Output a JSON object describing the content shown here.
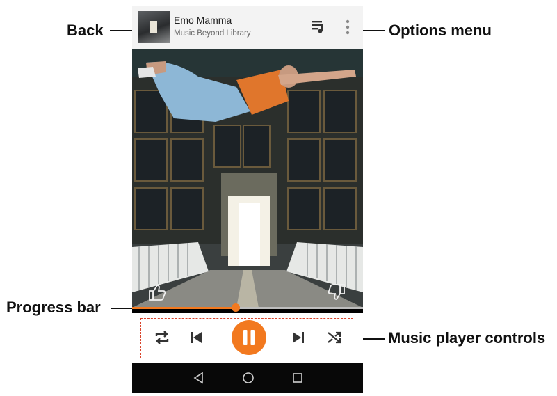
{
  "track": {
    "title": "Emo Mamma",
    "subtitle": "Music Beyond Library"
  },
  "callouts": {
    "back": "Back",
    "options_menu": "Options menu",
    "progress_bar": "Progress bar",
    "music_player_controls": "Music player controls"
  },
  "icons": {
    "back": "album-art-back-icon",
    "queue": "queue-icon",
    "options": "more-vert-icon",
    "thumbs_up": "thumbs-up-icon",
    "thumbs_down": "thumbs-down-icon",
    "repeat": "repeat-icon",
    "previous": "skip-previous-icon",
    "pause": "pause-icon",
    "next": "skip-next-icon",
    "shuffle": "shuffle-icon",
    "nav_back": "nav-back-icon",
    "nav_home": "nav-home-icon",
    "nav_recents": "nav-recents-icon"
  },
  "progress": {
    "fraction": 0.45
  },
  "colors": {
    "accent": "#f2791f",
    "callout_border": "#d9432b",
    "topbar": "#f3f3f3",
    "navbar": "#080808"
  }
}
